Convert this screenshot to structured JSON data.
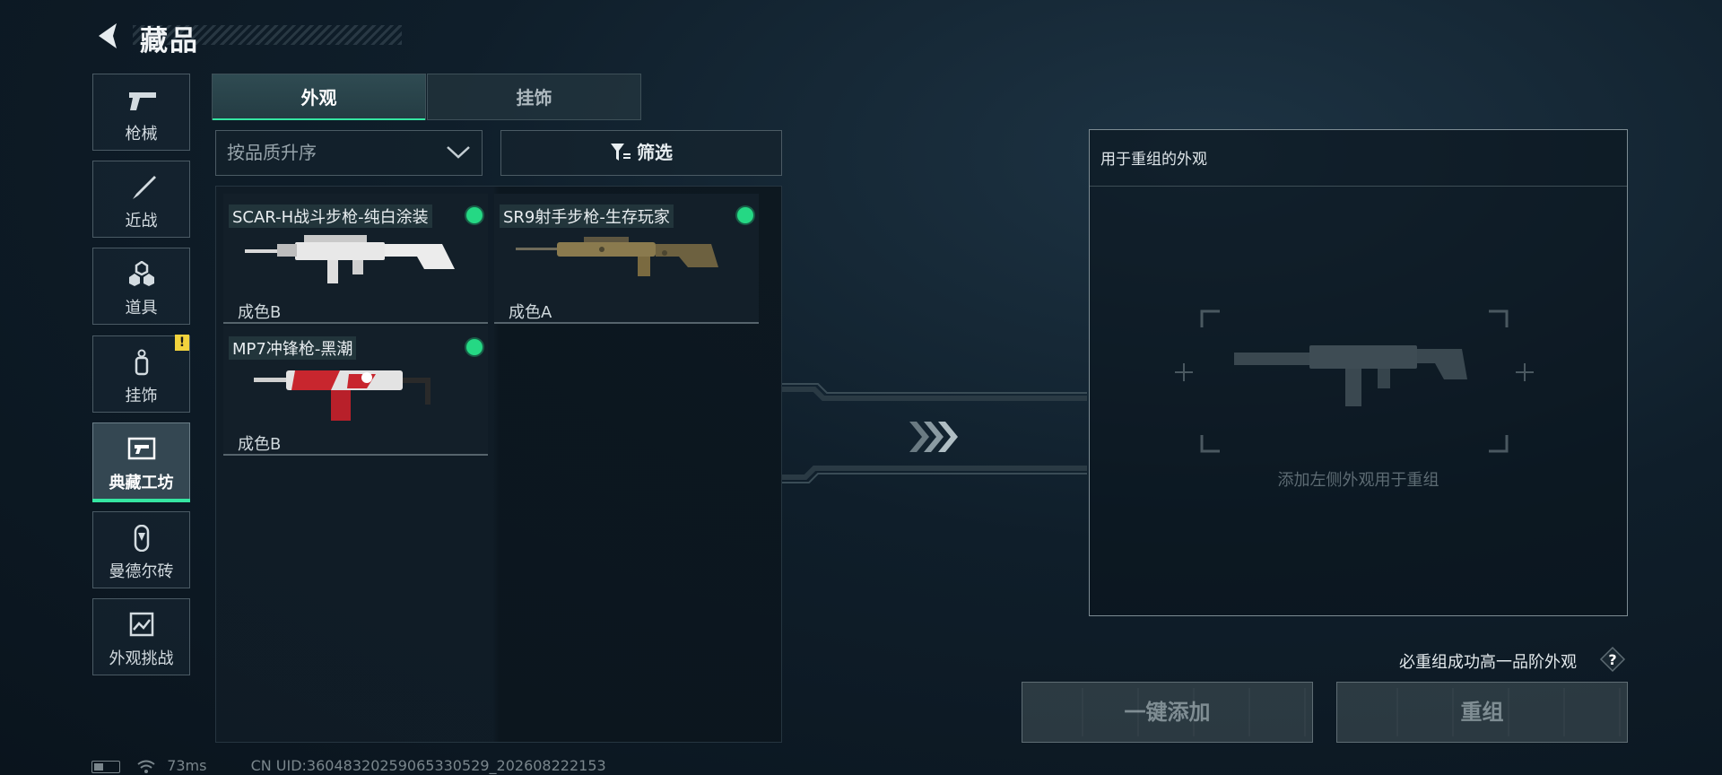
{
  "header": {
    "title": "藏品"
  },
  "nav": [
    {
      "label": "枪械",
      "icon": "pistol-icon"
    },
    {
      "label": "近战",
      "icon": "knife-icon"
    },
    {
      "label": "道具",
      "icon": "grenade-icon"
    },
    {
      "label": "挂饰",
      "icon": "pendant-icon",
      "badge": "!"
    },
    {
      "label": "典藏工坊",
      "icon": "workshop-icon",
      "active": true
    },
    {
      "label": "曼德尔砖",
      "icon": "mandel-brick-icon"
    },
    {
      "label": "外观挑战",
      "icon": "challenge-icon"
    }
  ],
  "tabs": {
    "skin": "外观",
    "pendant": "挂饰"
  },
  "sort": {
    "value": "按品质升序"
  },
  "filter": {
    "label": "筛选"
  },
  "items": [
    {
      "name": "SCAR-H战斗步枪-纯白涂装",
      "grade": "成色B",
      "color": "#e8e8e8"
    },
    {
      "name": "SR9射手步枪-生存玩家",
      "grade": "成色A",
      "color": "#8a7a4e"
    },
    {
      "name": "MP7冲锋枪-黑潮",
      "grade": "成色B",
      "color": "#c8262e"
    }
  ],
  "recombine": {
    "title": "用于重组的外观",
    "placeholder": "添加左侧外观用于重组",
    "hint": "必重组成功高一品阶外观",
    "help": "?",
    "add_button": "一键添加",
    "recombine_button": "重组"
  },
  "status": {
    "ping": "73ms",
    "uid": "CN UID:3604832025906533052­9_202608222153"
  },
  "colors": {
    "accent": "#35e6a2",
    "status_dot": "#25d884",
    "badge": "#f2d33d"
  }
}
